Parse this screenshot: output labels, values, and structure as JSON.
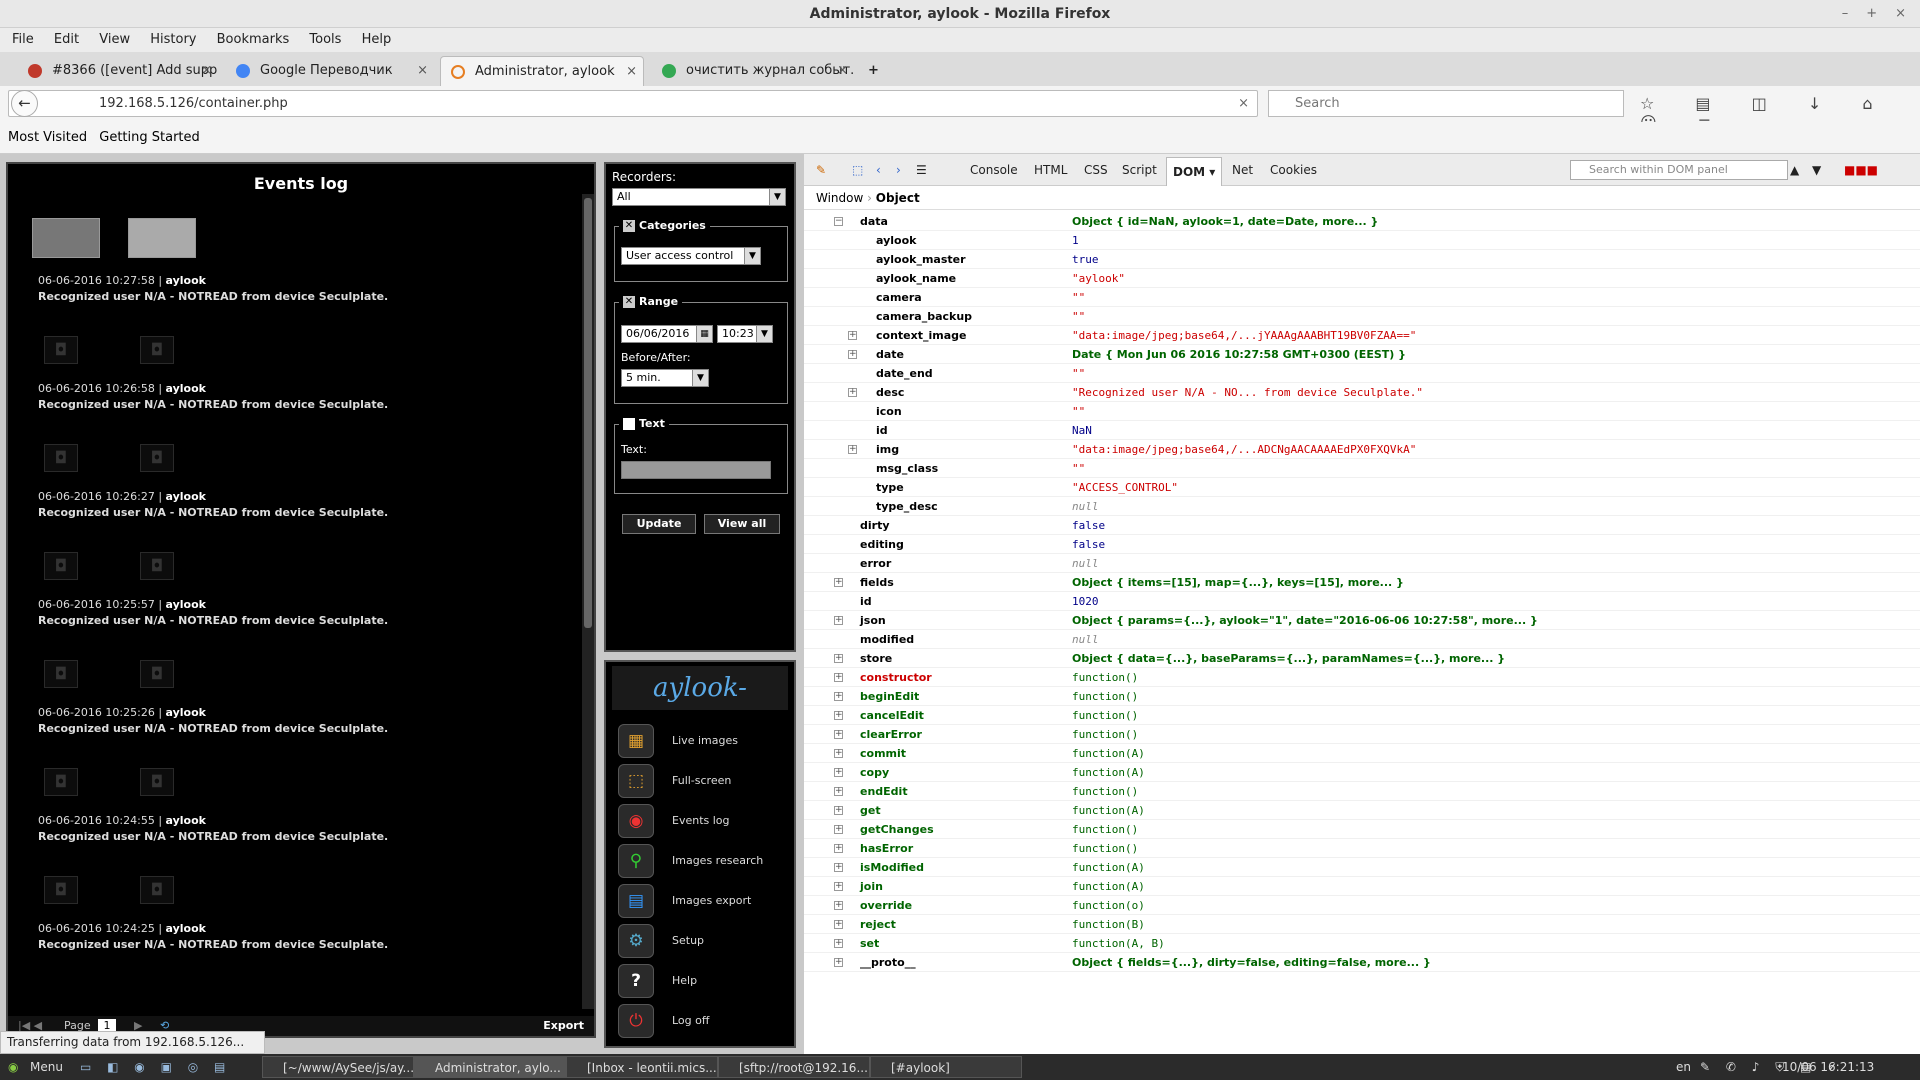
{
  "window": {
    "title": "Administrator, aylook - Mozilla Firefox",
    "ctrl_min": "–",
    "ctrl_max": "+",
    "ctrl_close": "×"
  },
  "menu": [
    "File",
    "Edit",
    "View",
    "History",
    "Bookmarks",
    "Tools",
    "Help"
  ],
  "tabs": [
    {
      "label": "#8366 ([event] Add supp...",
      "color": "#c0392b"
    },
    {
      "label": "Google Переводчик",
      "color": "#4285f4"
    },
    {
      "label": "Administrator, aylook",
      "color": "#e67e22"
    },
    {
      "label": "очистить журнал событ...",
      "color": "#34a853"
    }
  ],
  "tab_close": "×",
  "new_tab": "+",
  "nav": {
    "url": "192.168.5.126/container.php",
    "search_placeholder": "Search",
    "clear": "×",
    "back": "←",
    "toolbar_icons": "☆ ▤ ◫ ↓ ⌂ ☺ ≡"
  },
  "bookmarks": {
    "most_visited": "Most Visited",
    "getting_started": "Getting Started"
  },
  "events": {
    "title": "Events log",
    "entries": [
      {
        "time": "06-06-2016 10:27:58",
        "user": "aylook",
        "msg": "Recognized user N/A - NOTREAD from device Seculplate."
      },
      {
        "time": "06-06-2016 10:26:58",
        "user": "aylook",
        "msg": "Recognized user N/A - NOTREAD from device Seculplate."
      },
      {
        "time": "06-06-2016 10:26:27",
        "user": "aylook",
        "msg": "Recognized user N/A - NOTREAD from device Seculplate."
      },
      {
        "time": "06-06-2016 10:25:57",
        "user": "aylook",
        "msg": "Recognized user N/A - NOTREAD from device Seculplate."
      },
      {
        "time": "06-06-2016 10:25:26",
        "user": "aylook",
        "msg": "Recognized user N/A - NOTREAD from device Seculplate."
      },
      {
        "time": "06-06-2016 10:24:55",
        "user": "aylook",
        "msg": "Recognized user N/A - NOTREAD from device Seculplate."
      },
      {
        "time": "06-06-2016 10:24:25",
        "user": "aylook",
        "msg": "Recognized user N/A - NOTREAD from device Seculplate."
      }
    ],
    "page_label": "Page",
    "page_value": "1",
    "export": "Export"
  },
  "filters": {
    "recorders_label": "Recorders:",
    "recorders_value": "All",
    "categories_label": "Categories",
    "categories_value": "User access control",
    "range_label": "Range",
    "date_value": "06/06/2016",
    "time_value": "10:23",
    "before_after_label": "Before/After:",
    "before_after_value": "5 min.",
    "text_label": "Text",
    "text_field_label": "Text:",
    "update": "Update",
    "view_all": "View all"
  },
  "side_menu": {
    "logo": "aylook-",
    "items": [
      "Live images",
      "Full-screen",
      "Events log",
      "Images research",
      "Images export",
      "Setup",
      "Help",
      "Log off"
    ]
  },
  "status": "Transferring data from 192.168.5.126...",
  "devtools": {
    "tabs": [
      "Console",
      "HTML",
      "CSS",
      "Script",
      "DOM",
      "Net",
      "Cookies"
    ],
    "active": "DOM",
    "search_placeholder": "Search within DOM panel",
    "crumbs": [
      "Window",
      "Object"
    ],
    "rows": [
      {
        "key": "data",
        "value": "Object { id=NaN,  aylook=1,  date=Date,  more... }",
        "kind": "obj",
        "indent": 0,
        "expand": "−"
      },
      {
        "key": "aylook",
        "value": "1",
        "kind": "num",
        "indent": 1
      },
      {
        "key": "aylook_master",
        "value": "true",
        "kind": "num",
        "indent": 1
      },
      {
        "key": "aylook_name",
        "value": "\"aylook\"",
        "kind": "str",
        "indent": 1
      },
      {
        "key": "camera",
        "value": "\"\"",
        "kind": "str",
        "indent": 1
      },
      {
        "key": "camera_backup",
        "value": "\"\"",
        "kind": "str",
        "indent": 1
      },
      {
        "key": "context_image",
        "value": "\"data:image/jpeg;base64,/...jYAAAgAAABHT19BV0FZAA==\"",
        "kind": "str",
        "indent": 1,
        "expand": "+"
      },
      {
        "key": "date",
        "value": "Date { Mon Jun 06 2016 10:27:58 GMT+0300 (EEST) }",
        "kind": "obj",
        "indent": 1,
        "expand": "+"
      },
      {
        "key": "date_end",
        "value": "\"\"",
        "kind": "str",
        "indent": 1
      },
      {
        "key": "desc",
        "value": "\"Recognized user N/A - NO... from device Seculplate.\"",
        "kind": "str",
        "indent": 1,
        "expand": "+"
      },
      {
        "key": "icon",
        "value": "\"\"",
        "kind": "str",
        "indent": 1
      },
      {
        "key": "id",
        "value": "NaN",
        "kind": "num",
        "indent": 1
      },
      {
        "key": "img",
        "value": "\"data:image/jpeg;base64,/...ADCNgAACAAAAEdPX0FXQVkA\"",
        "kind": "str",
        "indent": 1,
        "expand": "+"
      },
      {
        "key": "msg_class",
        "value": "\"\"",
        "kind": "str",
        "indent": 1
      },
      {
        "key": "type",
        "value": "\"ACCESS_CONTROL\"",
        "kind": "str",
        "indent": 1
      },
      {
        "key": "type_desc",
        "value": "null",
        "kind": "nul",
        "indent": 1
      },
      {
        "key": "dirty",
        "value": "false",
        "kind": "num",
        "indent": 0
      },
      {
        "key": "editing",
        "value": "false",
        "kind": "num",
        "indent": 0
      },
      {
        "key": "error",
        "value": "null",
        "kind": "nul",
        "indent": 0
      },
      {
        "key": "fields",
        "value": "Object { items=[15],  map={...},  keys=[15],  more... }",
        "kind": "obj",
        "indent": 0,
        "expand": "+"
      },
      {
        "key": "id",
        "value": "1020",
        "kind": "num",
        "indent": 0
      },
      {
        "key": "json",
        "value": "Object { params={...},  aylook=\"1\",  date=\"2016-06-06 10:27:58\",  more... }",
        "kind": "obj",
        "indent": 0,
        "expand": "+"
      },
      {
        "key": "modified",
        "value": "null",
        "kind": "nul",
        "indent": 0
      },
      {
        "key": "store",
        "value": "Object { data={...},  baseParams={...},  paramNames={...},  more... }",
        "kind": "obj",
        "indent": 0,
        "expand": "+"
      },
      {
        "key": "constructor",
        "value": "function()",
        "kind": "fun",
        "indent": 0,
        "expand": "+",
        "ctor": true
      },
      {
        "key": "beginEdit",
        "value": "function()",
        "kind": "fun",
        "indent": 0,
        "expand": "+",
        "fn": true
      },
      {
        "key": "cancelEdit",
        "value": "function()",
        "kind": "fun",
        "indent": 0,
        "expand": "+",
        "fn": true
      },
      {
        "key": "clearError",
        "value": "function()",
        "kind": "fun",
        "indent": 0,
        "expand": "+",
        "fn": true
      },
      {
        "key": "commit",
        "value": "function(A)",
        "kind": "fun",
        "indent": 0,
        "expand": "+",
        "fn": true
      },
      {
        "key": "copy",
        "value": "function(A)",
        "kind": "fun",
        "indent": 0,
        "expand": "+",
        "fn": true
      },
      {
        "key": "endEdit",
        "value": "function()",
        "kind": "fun",
        "indent": 0,
        "expand": "+",
        "fn": true
      },
      {
        "key": "get",
        "value": "function(A)",
        "kind": "fun",
        "indent": 0,
        "expand": "+",
        "fn": true
      },
      {
        "key": "getChanges",
        "value": "function()",
        "kind": "fun",
        "indent": 0,
        "expand": "+",
        "fn": true
      },
      {
        "key": "hasError",
        "value": "function()",
        "kind": "fun",
        "indent": 0,
        "expand": "+",
        "fn": true
      },
      {
        "key": "isModified",
        "value": "function(A)",
        "kind": "fun",
        "indent": 0,
        "expand": "+",
        "fn": true
      },
      {
        "key": "join",
        "value": "function(A)",
        "kind": "fun",
        "indent": 0,
        "expand": "+",
        "fn": true
      },
      {
        "key": "override",
        "value": "function(o)",
        "kind": "fun",
        "indent": 0,
        "expand": "+",
        "fn": true
      },
      {
        "key": "reject",
        "value": "function(B)",
        "kind": "fun",
        "indent": 0,
        "expand": "+",
        "fn": true
      },
      {
        "key": "set",
        "value": "function(A, B)",
        "kind": "fun",
        "indent": 0,
        "expand": "+",
        "fn": true
      },
      {
        "key": "__proto__",
        "value": "Object { fields={...},  dirty=false,  editing=false,  more... }",
        "kind": "obj",
        "indent": 0,
        "expand": "+"
      }
    ]
  },
  "taskbar": {
    "start": "Menu",
    "tasks": [
      "[~/www/AySee/js/ay...",
      "Administrator, aylo...",
      "[Inbox - leontii.mics...",
      "[sftp://root@192.16...",
      "[#aylook]"
    ],
    "lang": "en",
    "clock": "10/06 16:21:13"
  }
}
